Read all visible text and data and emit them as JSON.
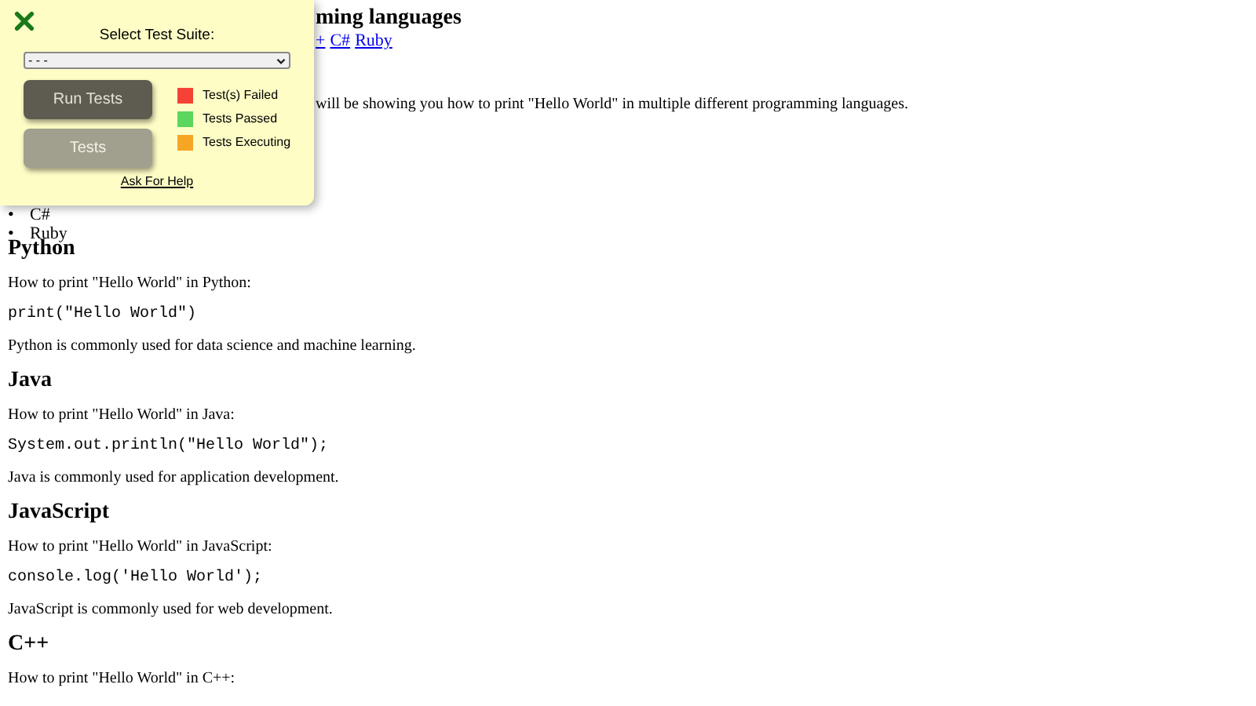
{
  "page": {
    "title": "ming languages",
    "nav": [
      "+",
      "C#",
      "Ruby"
    ],
    "intro_text": "will be showing you how to print \"Hello World\" in multiple different programming languages.",
    "list": {
      "marker": "•",
      "items": [
        "C#",
        "Ruby"
      ]
    },
    "sections": [
      {
        "heading": "Python",
        "blocks": [
          {
            "kind": "text",
            "text": "How to print \"Hello World\" in Python:"
          },
          {
            "kind": "code",
            "text": "print(\"Hello World\")"
          },
          {
            "kind": "text",
            "text": "Python is commonly used for data science and machine learning."
          }
        ]
      },
      {
        "heading": "Java",
        "blocks": [
          {
            "kind": "text",
            "text": "How to print \"Hello World\" in Java:"
          },
          {
            "kind": "code",
            "text": "System.out.println(\"Hello World\");"
          },
          {
            "kind": "text",
            "text": "Java is commonly used for application development."
          }
        ]
      },
      {
        "heading": "JavaScript",
        "blocks": [
          {
            "kind": "text",
            "text": "How to print \"Hello World\" in JavaScript:"
          },
          {
            "kind": "code",
            "text": "console.log('Hello World');"
          },
          {
            "kind": "text",
            "text": "JavaScript is commonly used for web development."
          }
        ]
      },
      {
        "heading": "C++",
        "blocks": [
          {
            "kind": "text",
            "text": "How to print \"Hello World\" in C++:"
          }
        ]
      }
    ]
  },
  "test_panel": {
    "select_label": "Select Test Suite:",
    "select_value": "- - -",
    "buttons": [
      {
        "label": "Run Tests",
        "disabled": false
      },
      {
        "label": "Tests",
        "disabled": true
      }
    ],
    "legend": [
      {
        "label": "Test(s) Failed",
        "color": "#f44336"
      },
      {
        "label": "Tests Passed",
        "color": "#5cd65c"
      },
      {
        "label": "Tests Executing",
        "color": "#f5a623"
      }
    ],
    "help_link": "Ask For Help"
  }
}
